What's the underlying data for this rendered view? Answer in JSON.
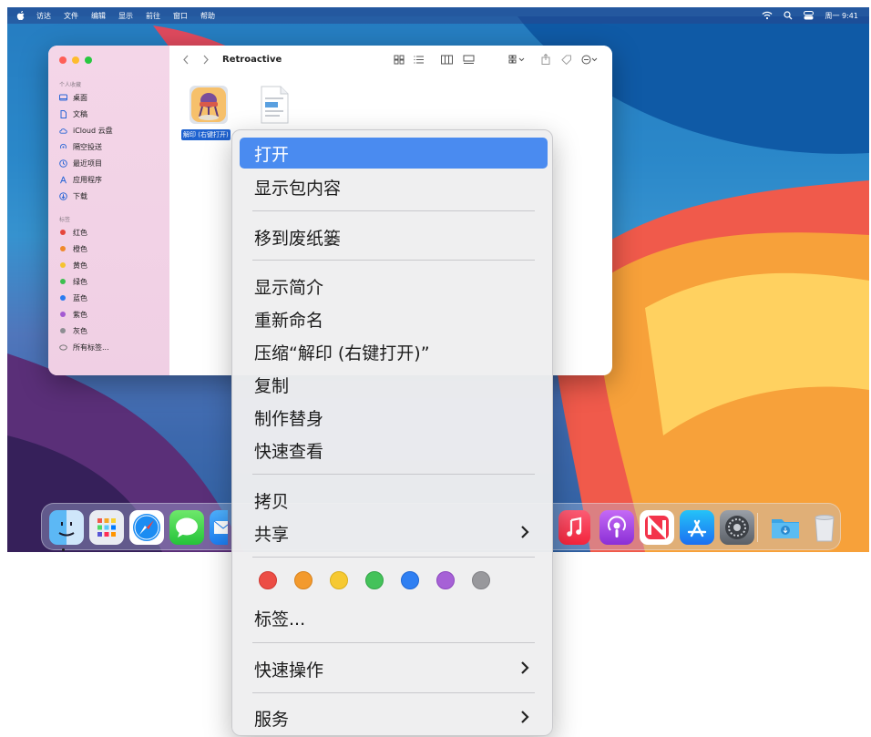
{
  "menubar": {
    "items": [
      "访达",
      "文件",
      "编辑",
      "显示",
      "前往",
      "窗口",
      "帮助"
    ],
    "clock": "周一 9:41"
  },
  "finder": {
    "folder_title": "Retroactive",
    "sidebar": {
      "favorites_heading": "个人收藏",
      "favorites": [
        {
          "label": "桌面",
          "icon": "desktop-icon"
        },
        {
          "label": "文稿",
          "icon": "document-icon"
        },
        {
          "label": "iCloud 云盘",
          "icon": "cloud-icon"
        },
        {
          "label": "隔空投送",
          "icon": "airdrop-icon"
        },
        {
          "label": "最近项目",
          "icon": "clock-icon"
        },
        {
          "label": "应用程序",
          "icon": "applications-icon"
        },
        {
          "label": "下载",
          "icon": "download-icon"
        }
      ],
      "tags_heading": "标签",
      "tags": [
        {
          "label": "红色",
          "color": "#e5463c"
        },
        {
          "label": "橙色",
          "color": "#f0892b"
        },
        {
          "label": "黄色",
          "color": "#f5c330"
        },
        {
          "label": "绿色",
          "color": "#3cbf4f"
        },
        {
          "label": "蓝色",
          "color": "#2a7bf0"
        },
        {
          "label": "紫色",
          "color": "#a45ad2"
        },
        {
          "label": "灰色",
          "color": "#8e8e93"
        },
        {
          "label": "所有标签...",
          "color": ""
        }
      ]
    },
    "selected_file_label": "解印 (右键打开)"
  },
  "context_menu": {
    "items": {
      "open": "打开",
      "show_package": "显示包内容",
      "move_to_trash": "移到废纸篓",
      "get_info": "显示简介",
      "rename": "重新命名",
      "compress": "压缩“解印 (右键打开)”",
      "duplicate": "复制",
      "make_alias": "制作替身",
      "quick_look": "快速查看",
      "copy": "拷贝",
      "share": "共享",
      "tags": "标签...",
      "quick_actions": "快速操作",
      "services": "服务"
    },
    "tag_colors": [
      "#ec4d45",
      "#f39a2d",
      "#f6c932",
      "#44c25a",
      "#2f7ff2",
      "#a661d6",
      "#98989c"
    ]
  },
  "dock": {
    "icons": [
      "finder-icon",
      "launchpad-icon",
      "safari-icon",
      "messages-icon",
      "mail-icon",
      "music-icon",
      "podcasts-icon",
      "news-icon",
      "app-store-icon",
      "system-preferences-icon",
      "downloads-folder-icon",
      "trash-icon"
    ]
  }
}
